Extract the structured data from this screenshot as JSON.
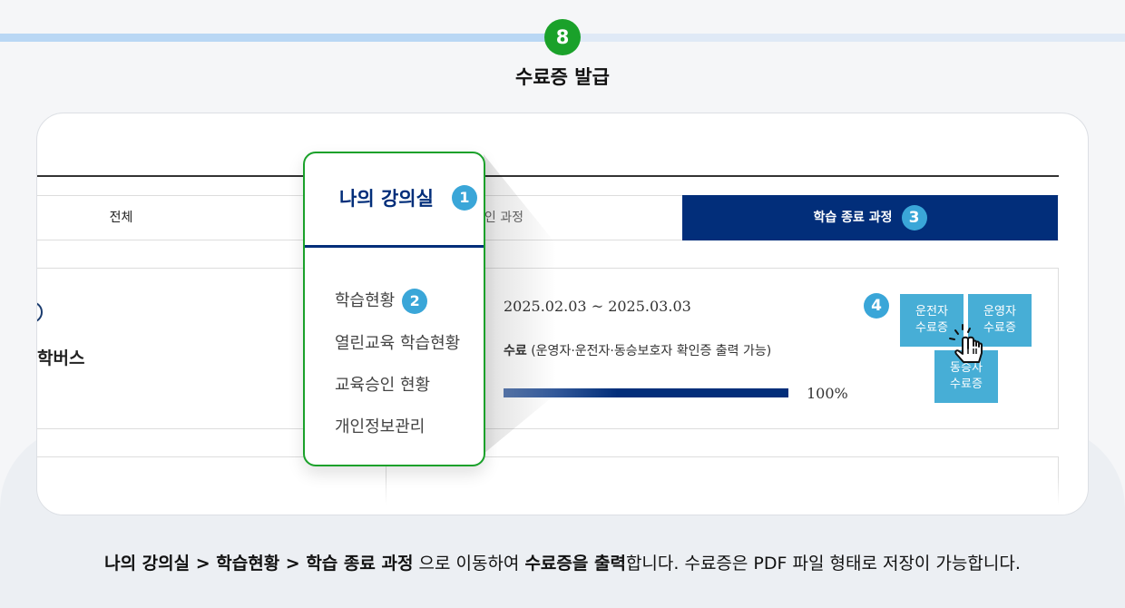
{
  "step": {
    "number": "8",
    "title": "수료증 발급"
  },
  "tabs": [
    {
      "label": "전체"
    },
    {
      "label": "승인 과정"
    },
    {
      "label": "학습 종료 과정",
      "badge": "3"
    }
  ],
  "course": {
    "title_partial": "학버스",
    "date_range": "2025.02.03 ~ 2025.03.03",
    "status": "수료",
    "status_note": "(운영자·운전자·동승보호자 확인증 출력 가능)",
    "progress_percent": 100,
    "progress_label": "100%",
    "step_badge": "4",
    "certificates": [
      {
        "line1": "운전자",
        "line2": "수료증"
      },
      {
        "line1": "운영자",
        "line2": "수료증"
      },
      {
        "line1": "동승자",
        "line2": "수료증"
      }
    ]
  },
  "menu": {
    "title": "나의 강의실",
    "title_badge": "1",
    "items": [
      {
        "label": "학습현황",
        "badge": "2"
      },
      {
        "label": "열린교육 학습현황"
      },
      {
        "label": "교육승인 현황"
      },
      {
        "label": "개인정보관리"
      }
    ]
  },
  "caption": {
    "part1": "나의 강의실 > 학습현황 > 학습 종료 과정",
    "part2": " 으로 이동하여 ",
    "part3": "수료증을 출력",
    "part4": "합니다. 수료증은 PDF 파일 형태로 저장이 가능합니다."
  },
  "colors": {
    "accent_green": "#1aa12a",
    "navy": "#022e7a",
    "badge_blue": "#3aa6d8",
    "button_blue": "#47aed6"
  }
}
